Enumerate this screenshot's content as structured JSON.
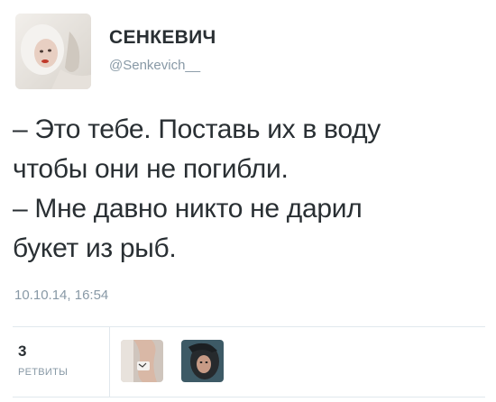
{
  "tweet": {
    "author": {
      "name": "СЕНКЕВИЧ",
      "handle": "@Senkevich__"
    },
    "text_lines": [
      "– Это тебе. Поставь их в воду",
      "чтобы они не погибли.",
      "– Мне давно никто не дарил",
      "букет из рыб."
    ],
    "timestamp": "10.10.14, 16:54",
    "stats": {
      "retweet_count": "3",
      "retweet_label": "РЕТВИТЫ"
    },
    "retweeter_avatars": [
      "retweeter-avatar-1",
      "retweeter-avatar-2"
    ]
  },
  "colors": {
    "text": "#292f33",
    "secondary_text": "#8899a6",
    "divider": "#e1e8ed"
  }
}
